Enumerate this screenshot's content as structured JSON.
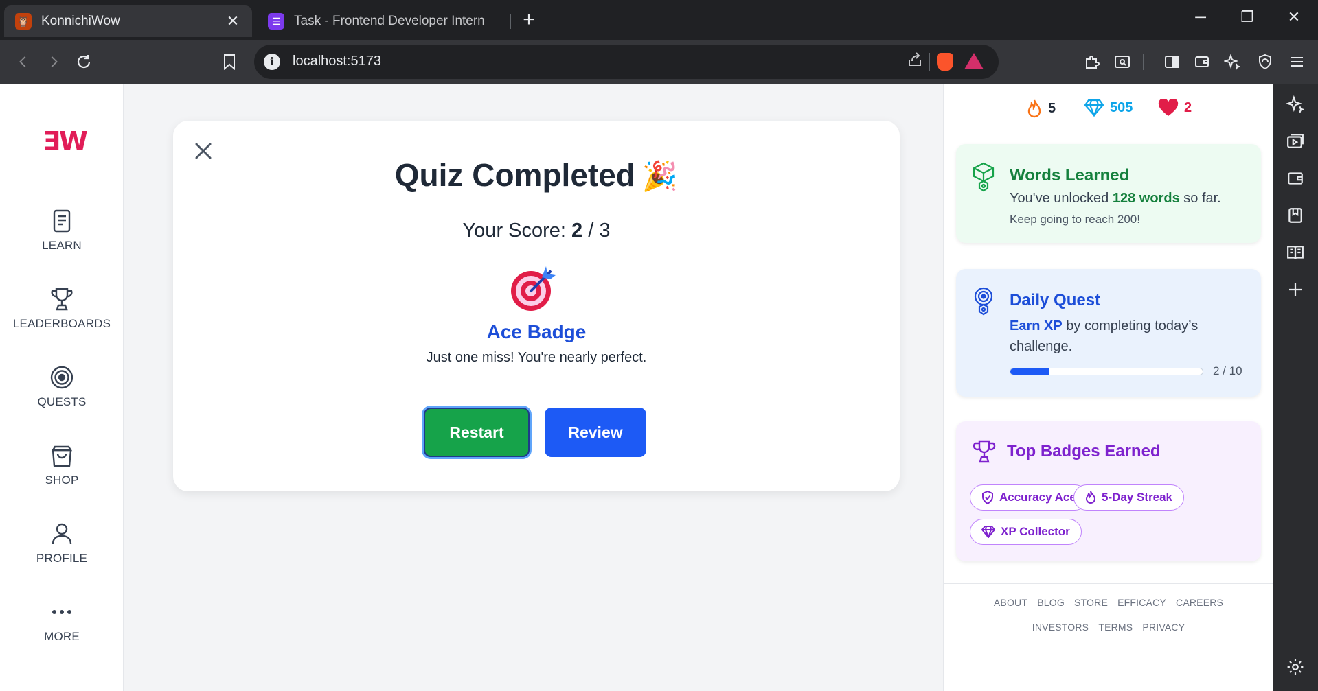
{
  "browser": {
    "tabs": [
      {
        "title": "KonnichiWow",
        "active": true
      },
      {
        "title": "Task - Frontend Developer Intern",
        "active": false
      }
    ],
    "url": "localhost:5173"
  },
  "nav": {
    "logo": "ƎW",
    "items": [
      {
        "label": "LEARN",
        "icon": "book-icon"
      },
      {
        "label": "LEADERBOARDS",
        "icon": "trophy-icon"
      },
      {
        "label": "QUESTS",
        "icon": "target-icon"
      },
      {
        "label": "SHOP",
        "icon": "shopping-bag-icon"
      },
      {
        "label": "PROFILE",
        "icon": "user-icon"
      },
      {
        "label": "MORE",
        "icon": "more-dots-icon"
      }
    ]
  },
  "quiz": {
    "title": "Quiz Completed",
    "title_emoji": "🎉",
    "score_label": "Your Score:",
    "score": "2",
    "score_sep": "/",
    "total": "3",
    "badge_emoji": "🎯",
    "badge_name": "Ace Badge",
    "badge_desc": "Just one miss! You're nearly perfect.",
    "restart_label": "Restart",
    "review_label": "Review"
  },
  "stats": {
    "streak": "5",
    "gems": "505",
    "hearts": "2",
    "colors": {
      "streak": "#f97316",
      "gems": "#0ea5e9",
      "hearts": "#e11d48"
    }
  },
  "words_card": {
    "title": "Words Learned",
    "text_before": "You've unlocked",
    "highlight": "128 words",
    "text_after": "so far.",
    "subtext": "Keep going to reach 200!"
  },
  "quest_card": {
    "title": "Daily Quest",
    "highlight": "Earn XP",
    "text": "by completing today’s challenge.",
    "progress_text": "2 / 10",
    "progress_value": 0.2
  },
  "badges_card": {
    "title": "Top Badges Earned",
    "badges": [
      {
        "label": "Accuracy Ace",
        "icon": "shield-check-icon"
      },
      {
        "label": "5-Day Streak",
        "icon": "flame-icon"
      },
      {
        "label": "XP Collector",
        "icon": "gem-icon"
      }
    ]
  },
  "footer": {
    "row1": [
      "ABOUT",
      "BLOG",
      "STORE",
      "EFFICACY",
      "CAREERS"
    ],
    "row2": [
      "INVESTORS",
      "TERMS",
      "PRIVACY"
    ]
  }
}
